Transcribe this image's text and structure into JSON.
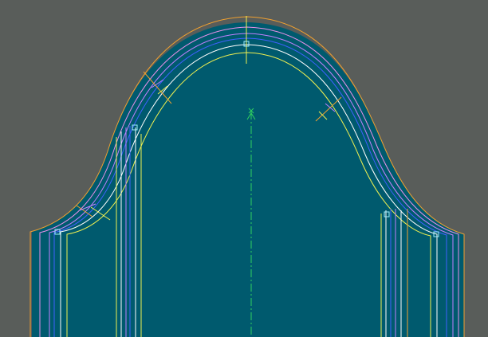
{
  "canvas": {
    "background": "#595d5a",
    "fill_color": "#005a6e"
  },
  "outline_colors": {
    "outer_offset": "#f0a030",
    "inner_offset": "#e890e8",
    "stitch_line": "#c080ff",
    "seam_line": "#4060ff",
    "pattern_edge": "#ffffff",
    "grain_line": "#f0f050",
    "center_axis": "#30d060",
    "control_point": "#9ff0ff"
  },
  "markers": {
    "center_marker": "×",
    "axis_arrow": "arrow-up"
  }
}
